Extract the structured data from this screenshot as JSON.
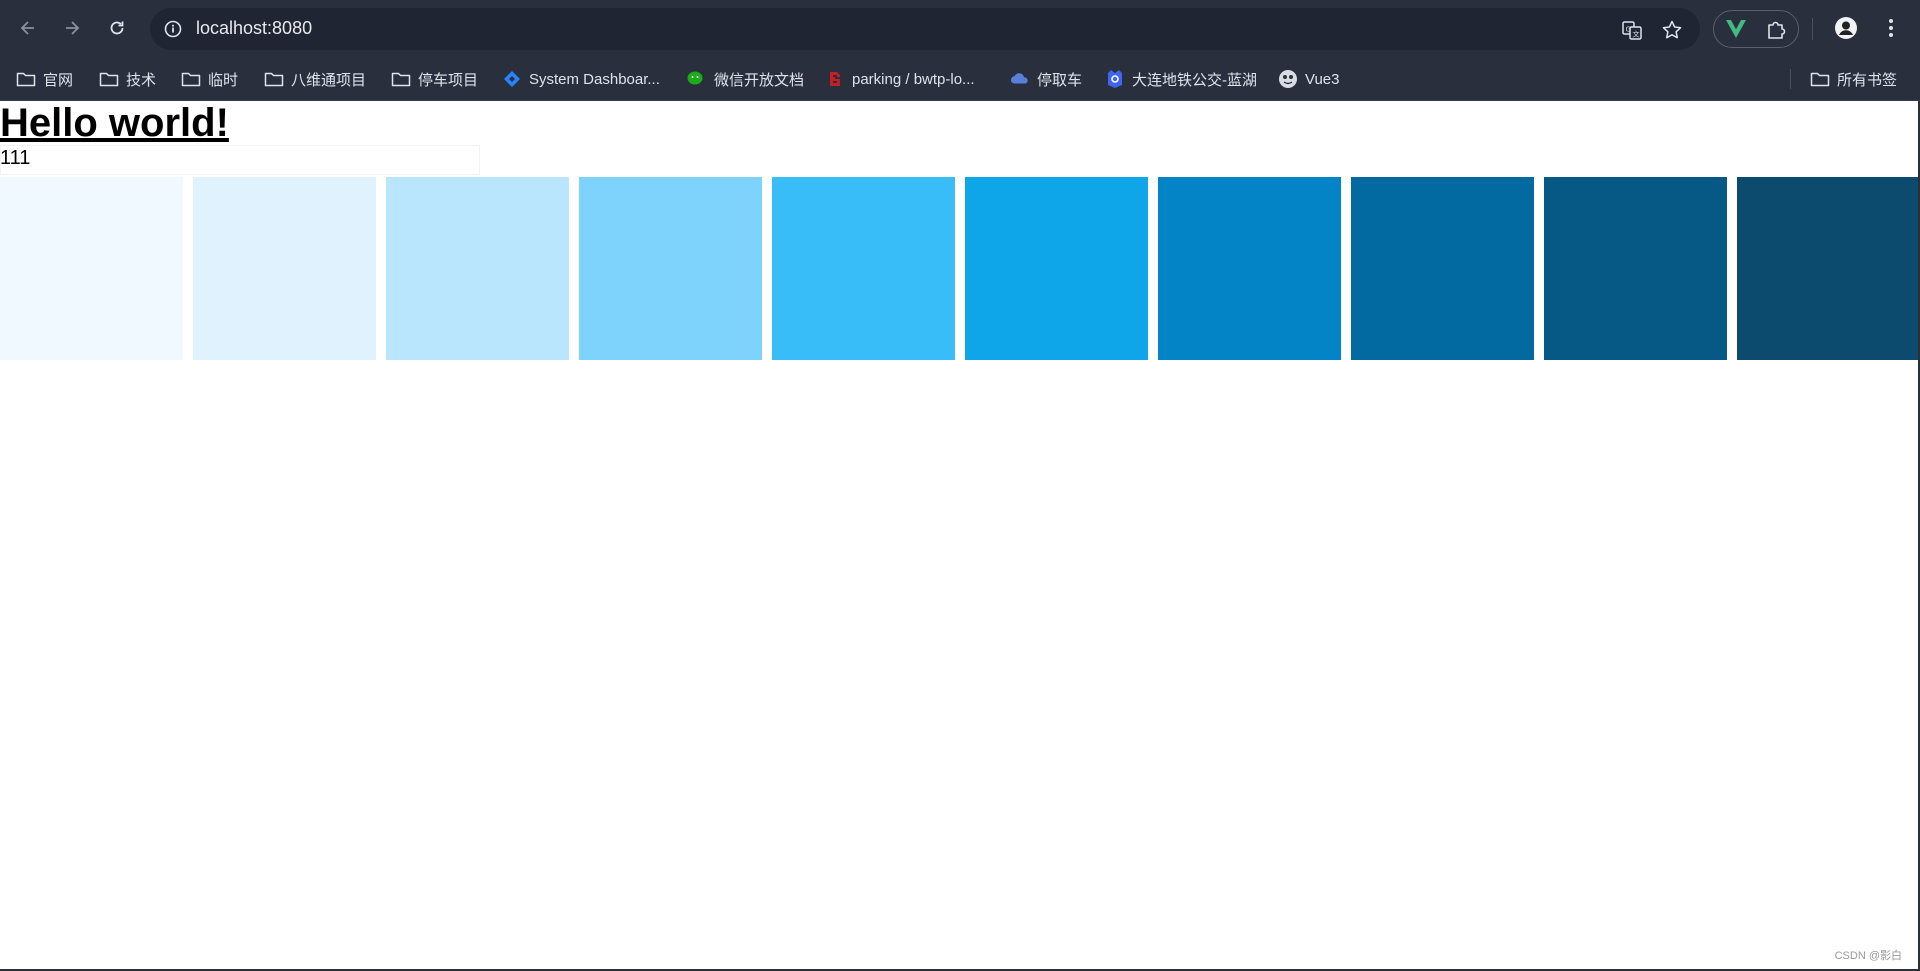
{
  "browser": {
    "address": "localhost:8080",
    "bookmarks": [
      {
        "label": "官网",
        "icon": "folder-icon"
      },
      {
        "label": "技术",
        "icon": "folder-icon"
      },
      {
        "label": "临时",
        "icon": "folder-icon"
      },
      {
        "label": "八维通项目",
        "icon": "folder-icon"
      },
      {
        "label": "停车项目",
        "icon": "folder-icon"
      },
      {
        "label": "System Dashboar...",
        "icon": "jira-icon"
      },
      {
        "label": "微信开放文档",
        "icon": "wechat-icon"
      },
      {
        "label": "parking / bwtp-lo...",
        "icon": "gitee-icon"
      },
      {
        "label": "停取车",
        "icon": "cloud-icon"
      },
      {
        "label": "大连地铁公交-蓝湖",
        "icon": "lanhu-icon"
      },
      {
        "label": "Vue3",
        "icon": "vue3-avatar-icon"
      }
    ],
    "all_bookmarks_label": "所有书签"
  },
  "page": {
    "heading": "Hello world!",
    "count": "111",
    "swatches": [
      {
        "color": "#f0f9ff"
      },
      {
        "color": "#e0f2fe"
      },
      {
        "color": "#bae6fd"
      },
      {
        "color": "#7dd3fc"
      },
      {
        "color": "#38bdf8"
      },
      {
        "color": "#0ea5e9"
      },
      {
        "color": "#0284c7"
      },
      {
        "color": "#0369a1"
      },
      {
        "color": "#075985"
      },
      {
        "color": "#0c4a6e"
      }
    ]
  },
  "watermark": "CSDN @影白",
  "colors": {
    "chrome_bg": "#292f3c",
    "omnibox_bg": "#1f2532",
    "vue_green": "#42b883"
  }
}
